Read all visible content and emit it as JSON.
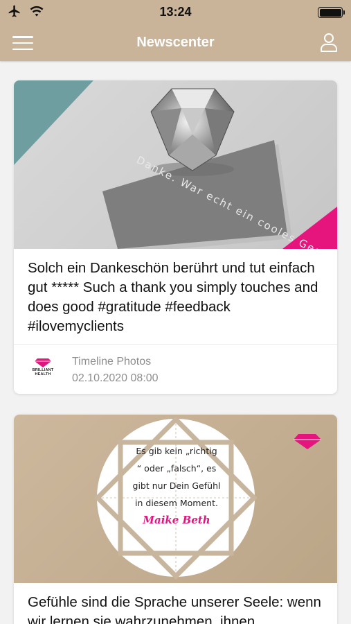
{
  "status_bar": {
    "time": "13:24",
    "icons": [
      "airplane-icon",
      "wifi-icon",
      "battery-icon"
    ]
  },
  "nav": {
    "title": "Newscenter",
    "left_icon": "menu-icon",
    "right_icon": "profile-icon",
    "background": "#c9b49a"
  },
  "posts": [
    {
      "image_caption": "Danke. War echt ein cooles Gespräch.",
      "text": "Solch ein Dankeschön berührt und tut einfach gut ***** Such a thank you simply touches and does good #gratitude #feedback #ilovemyclients",
      "logo_text": "BRILLIANT HEALTH",
      "source": "Timeline Photos",
      "date": "02.10.2020 08:00"
    },
    {
      "quote_lines": [
        "Es gib kein „richtig",
        "“ oder „falsch“, es",
        "gibt nur Dein Gefühl",
        "in diesem Moment."
      ],
      "quote_author": "Maike Beth",
      "text": "Gefühle sind die Sprache unserer Seele: wenn wir lernen sie wahrzunehmen, ihnen"
    }
  ],
  "colors": {
    "accent_pink": "#e0157f",
    "accent_teal": "#6f9ea0",
    "meta_gray": "#8e8e8e"
  }
}
